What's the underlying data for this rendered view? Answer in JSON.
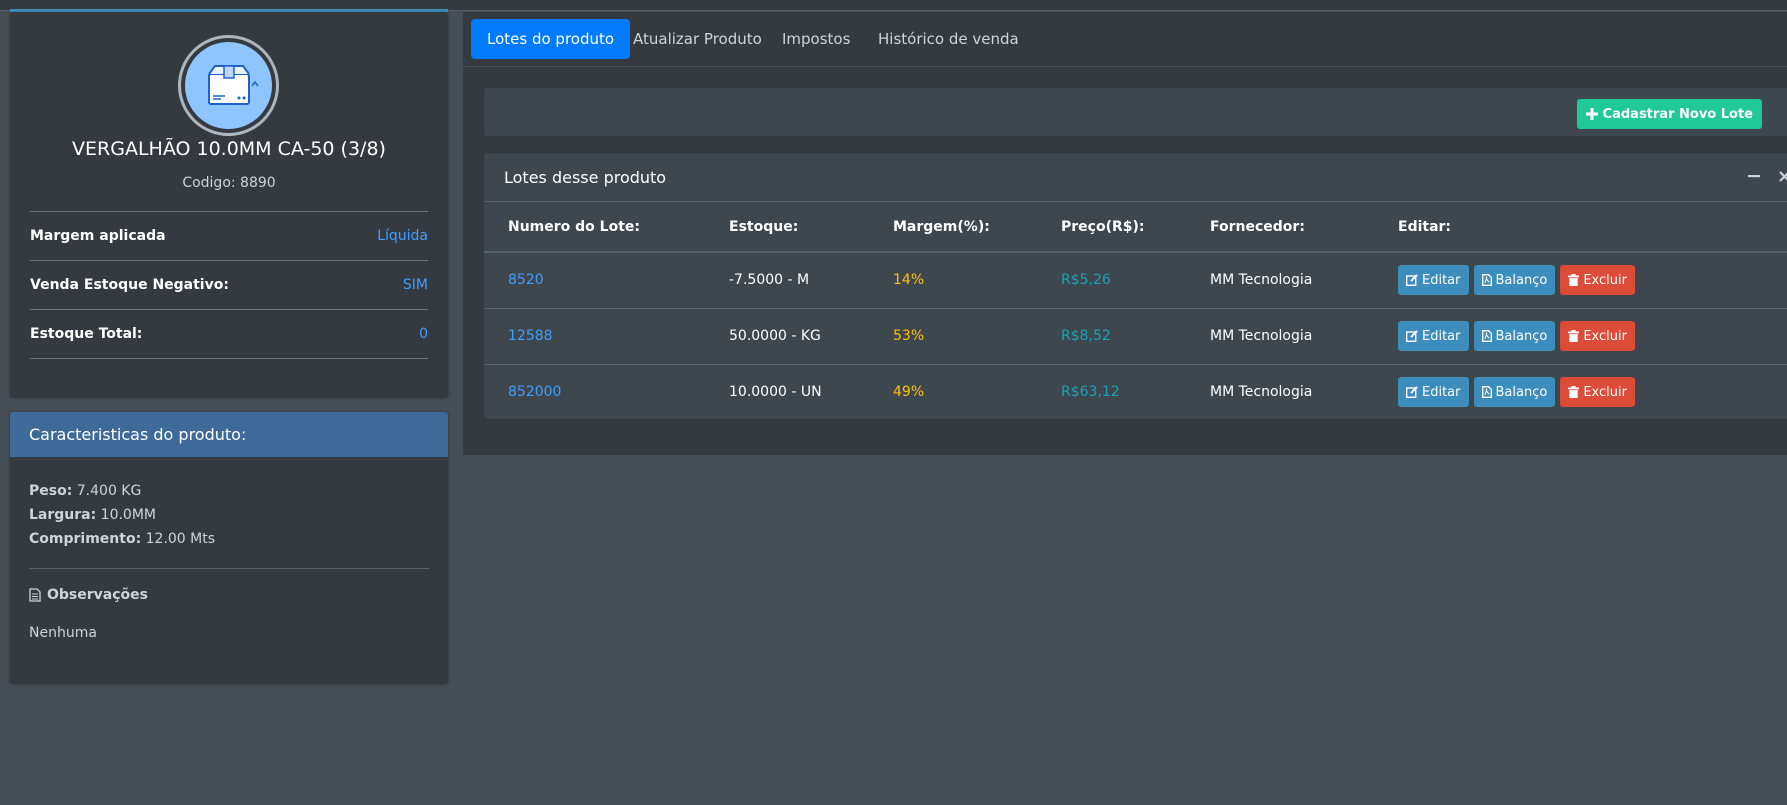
{
  "product": {
    "name": "VERGALHÃO 10.0MM CA-50 (3/8)",
    "code": "Codigo: 8890",
    "details": [
      {
        "label": "Margem aplicada",
        "value": "Líquida"
      },
      {
        "label": "Venda Estoque Negativo:",
        "value": "SIM"
      },
      {
        "label": "Estoque Total:",
        "value": "0"
      }
    ]
  },
  "characteristics": {
    "title": "Caracteristicas do produto:",
    "peso_label": "Peso:",
    "peso_value": "7.400 KG",
    "largura_label": "Largura:",
    "largura_value": "10.0MM",
    "comprimento_label": "Comprimento:",
    "comprimento_value": "12.00 Mts",
    "obs_title": "Observações",
    "obs_text": "Nenhuma"
  },
  "tabs": [
    {
      "label": "Lotes do produto",
      "active": true
    },
    {
      "label": "Atualizar Produto",
      "active": false
    },
    {
      "label": "Impostos",
      "active": false
    },
    {
      "label": "Histórico de venda",
      "active": false
    }
  ],
  "toolbar": {
    "new_lote_label": "Cadastrar Novo Lote"
  },
  "lotes": {
    "title": "Lotes desse produto",
    "headers": [
      "Numero do Lote:",
      "Estoque:",
      "Margem(%):",
      "Preço(R$):",
      "Fornecedor:",
      "Editar:"
    ],
    "rows": [
      {
        "numero": "8520",
        "estoque": "-7.5000 - M",
        "margem": "14%",
        "preco": "R$5,26",
        "fornecedor": "MM Tecnologia"
      },
      {
        "numero": "12588",
        "estoque": "50.0000 - KG",
        "margem": "53%",
        "preco": "R$8,52",
        "fornecedor": "MM Tecnologia"
      },
      {
        "numero": "852000",
        "estoque": "10.0000 - UN",
        "margem": "49%",
        "preco": "R$63,12",
        "fornecedor": "MM Tecnologia"
      }
    ],
    "actions": {
      "edit": "Editar",
      "balance": "Balanço",
      "delete": "Excluir"
    }
  },
  "colors": {
    "background": "#454d55",
    "card": "#343a40",
    "primary": "#007bff",
    "info": "#3c8dbc",
    "danger": "#dd4b39",
    "success": "#20c997",
    "warning": "#ffc107"
  }
}
